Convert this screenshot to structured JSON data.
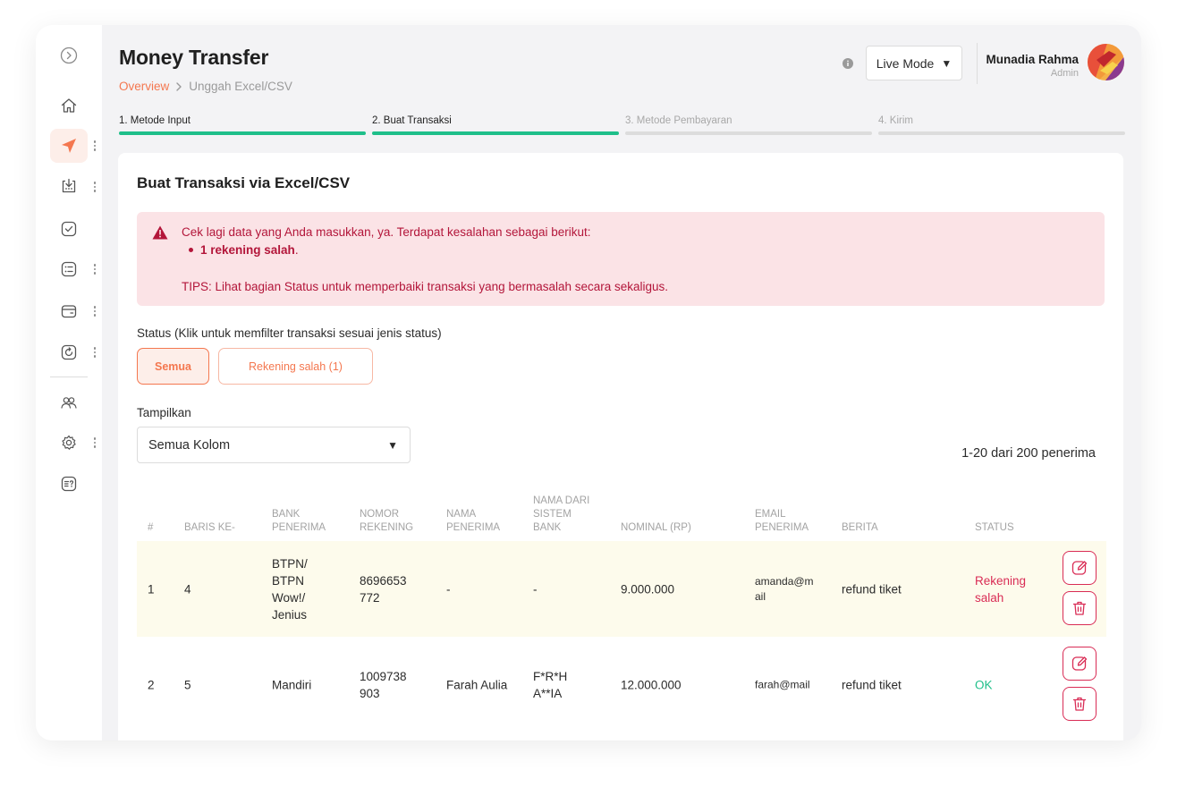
{
  "page": {
    "title": "Money Transfer",
    "breadcrumb": {
      "overview": "Overview",
      "current": "Unggah Excel/CSV"
    }
  },
  "header": {
    "mode": "Live Mode",
    "user": {
      "name": "Munadia Rahma",
      "role": "Admin"
    }
  },
  "steps": [
    {
      "label": "1. Metode Input",
      "state": "done"
    },
    {
      "label": "2. Buat Transaksi",
      "state": "done"
    },
    {
      "label": "3. Metode Pembayaran",
      "state": "pending"
    },
    {
      "label": "4. Kirim",
      "state": "pending"
    }
  ],
  "card": {
    "title": "Buat Transaksi via Excel/CSV",
    "alert": {
      "message": "Cek lagi data yang Anda masukkan, ya. Terdapat kesalahan sebagai berikut:",
      "bullet_bold": "1 rekening salah",
      "bullet_suffix": ".",
      "tips": "TIPS: Lihat bagian Status untuk memperbaiki transaksi yang bermasalah secara sekaligus."
    },
    "status_label": "Status (Klik untuk memfilter transaksi sesuai jenis status)",
    "filters": {
      "all": "Semua",
      "error": "Rekening salah (1)"
    },
    "show_label": "Tampilkan",
    "show_value": "Semua Kolom",
    "count": "1-20 dari 200 penerima"
  },
  "table": {
    "columns": {
      "no": "#",
      "row": "BARIS KE-",
      "bank": [
        "BANK",
        "PENERIMA"
      ],
      "account": [
        "NOMOR",
        "REKENING"
      ],
      "name": [
        "NAMA",
        "PENERIMA"
      ],
      "system_name": [
        "NAMA DARI",
        "SISTEM",
        "BANK"
      ],
      "amount": "NOMINAL (RP)",
      "email": [
        "EMAIL",
        "PENERIMA"
      ],
      "note": "BERITA",
      "status": "STATUS"
    },
    "rows": [
      {
        "no": "1",
        "row": "4",
        "bank": [
          "BTPN/",
          "BTPN",
          "Wow!/",
          "Jenius"
        ],
        "account": [
          "8696653",
          "772"
        ],
        "name": "-",
        "system_name": [
          "-"
        ],
        "amount": "9.000.000",
        "email": [
          "amanda@m",
          "ail"
        ],
        "note": "refund tiket",
        "status": [
          "Rekening",
          "salah"
        ],
        "status_type": "error"
      },
      {
        "no": "2",
        "row": "5",
        "bank": [
          "Mandiri"
        ],
        "account": [
          "1009738",
          "903"
        ],
        "name": "Farah Aulia",
        "system_name": [
          "F*R*H",
          "A**IA"
        ],
        "amount": "12.000.000",
        "email": [
          "farah@mail"
        ],
        "note": "refund tiket",
        "status": [
          "OK"
        ],
        "status_type": "ok"
      }
    ]
  },
  "colors": {
    "accent": "#f4774f",
    "success": "#1fbf8a",
    "danger": "#d92c55",
    "alert_bg": "#fbe3e6"
  },
  "icons": {
    "sidebar": [
      "expand-icon",
      "home-icon",
      "send-icon",
      "inbox-icon",
      "check-icon",
      "list-icon",
      "wallet-icon",
      "history-icon",
      "users-icon",
      "settings-icon",
      "help-icon"
    ],
    "actions": [
      "edit-icon",
      "trash-icon"
    ]
  }
}
